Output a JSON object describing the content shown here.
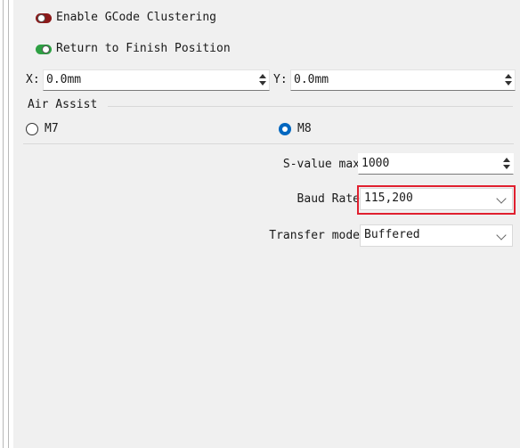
{
  "options": {
    "gcode_clustering": {
      "label": "Enable GCode Clustering",
      "enabled": false,
      "color": "#8b1a1a"
    },
    "return_finish": {
      "label": "Return to Finish Position",
      "enabled": true,
      "color": "#2ea043"
    }
  },
  "position": {
    "x_label": "X:",
    "x_value": "0.0mm",
    "y_label": "Y:",
    "y_value": "0.0mm"
  },
  "air_assist": {
    "title": "Air Assist",
    "m7_label": "M7",
    "m8_label": "M8",
    "selected": "M8"
  },
  "settings": {
    "s_value_label": "S-value max",
    "s_value": "1000",
    "baud_label": "Baud Rate",
    "baud_value": "115,200",
    "transfer_label": "Transfer mode",
    "transfer_value": "Buffered"
  },
  "colors": {
    "accent": "#0067c0",
    "highlight": "#e0202f"
  }
}
